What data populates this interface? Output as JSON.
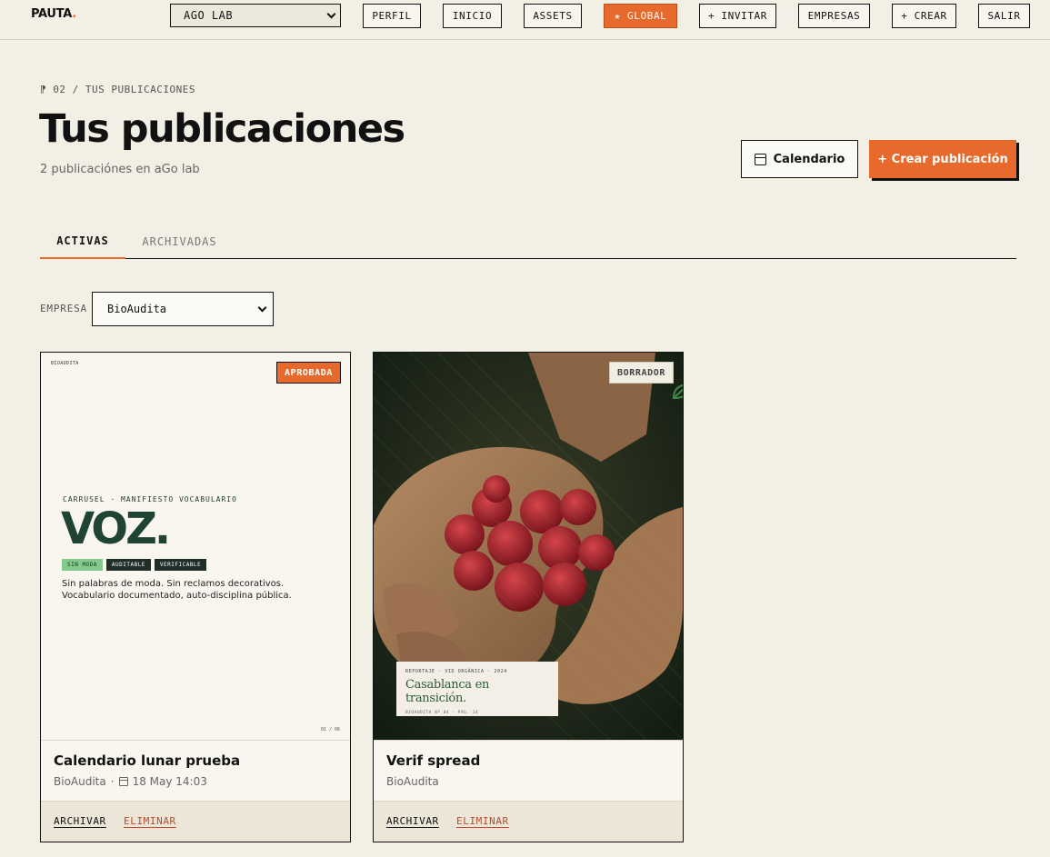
{
  "nav": {
    "logo": "PAUTA",
    "logo_dot": ".",
    "workspace": "AGO LAB",
    "buttons": [
      "PERFIL",
      "INICIO",
      "ASSETS",
      "★ GLOBAL",
      "+ INVITAR",
      "EMPRESAS",
      "+ CREAR",
      "SALIR"
    ]
  },
  "header": {
    "breadcrumb": "⁋ 02 / TUS PUBLICACIONES",
    "title": "Tus publicaciones",
    "subtitle": "2 publicaciónes en aGo lab",
    "calendar_label": "Calendario",
    "create_label": "+ Crear publicación"
  },
  "tabs": [
    "ACTIVAS",
    "ARCHIVADAS"
  ],
  "filter": {
    "label": "EMPRESA",
    "value": "BioAudita"
  },
  "cards": [
    {
      "status": "APROBADA",
      "title": "Calendario lunar prueba",
      "company": "BioAudita",
      "meta_sep": "·",
      "date": "18 May 14:03",
      "archive": "ARCHIVAR",
      "delete": "ELIMINAR",
      "preview": {
        "brand": "BIOAUDITA",
        "kicker": "CARRUSEL · MANIFIESTO VOCABULARIO",
        "headline": "VOZ.",
        "tags": [
          "SIN MODA",
          "AUDITABLE",
          "VERIFICABLE"
        ],
        "body": "Sin palabras de moda. Sin reclamos decorativos. Vocabulario documentado, auto-disciplina pública.",
        "pager": "01 / 06"
      }
    },
    {
      "status": "BORRADOR",
      "title": "Verif spread",
      "company": "BioAudita",
      "archive": "ARCHIVAR",
      "delete": "ELIMINAR",
      "preview": {
        "kicker": "REPORTAJE · VID ORGÁNICA · 2024",
        "headline": "Casablanca en transición.",
        "footer": "BIOAUDITA Nº 04 · PÁG. 14"
      }
    }
  ],
  "colors": {
    "accent": "#e8692c",
    "background": "#f2efe4",
    "ink": "#111111",
    "danger": "#c0482d",
    "forest": "#1f4434"
  }
}
